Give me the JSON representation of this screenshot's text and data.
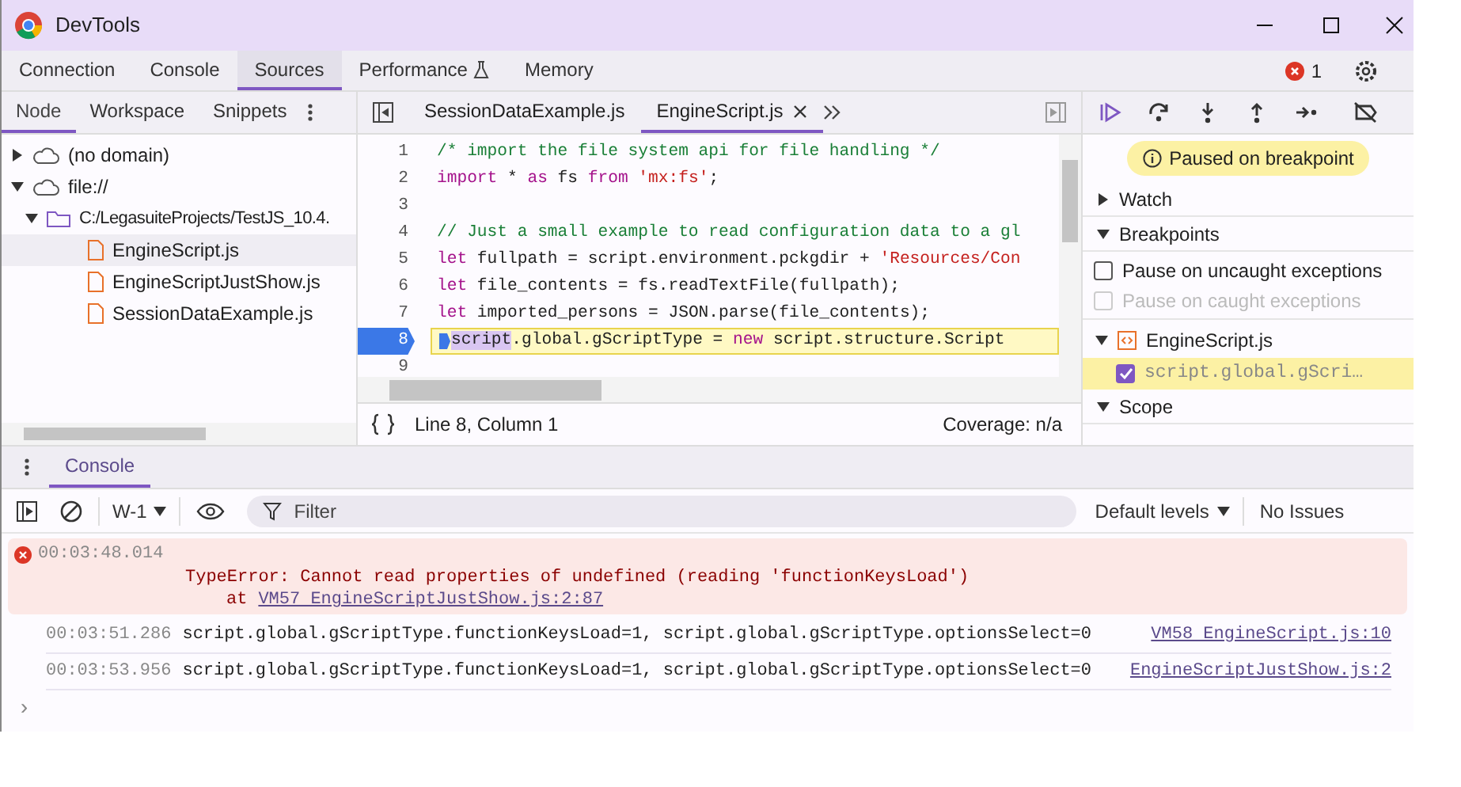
{
  "window": {
    "title": "DevTools"
  },
  "main_tabs": [
    {
      "label": "Connection",
      "selected": false,
      "kind": "plain"
    },
    {
      "label": "Console",
      "selected": false,
      "kind": "plain"
    },
    {
      "label": "Sources",
      "selected": true,
      "kind": "plain"
    },
    {
      "label": "Performance",
      "selected": false,
      "kind": "experimental"
    },
    {
      "label": "Memory",
      "selected": false,
      "kind": "plain"
    }
  ],
  "error_badge": {
    "count": "1"
  },
  "navigator": {
    "tabs": [
      {
        "label": "Node",
        "selected": true
      },
      {
        "label": "Workspace",
        "selected": false
      },
      {
        "label": "Snippets",
        "selected": false
      }
    ],
    "tree": [
      {
        "label": "(no domain)",
        "kind": "domain",
        "expanded": false
      },
      {
        "label": "file://",
        "kind": "domain",
        "expanded": true,
        "children": [
          {
            "label": "C:/LegasuiteProjects/TestJS_10.4.",
            "kind": "folder",
            "expanded": true,
            "children": [
              {
                "label": "EngineScript.js",
                "kind": "file",
                "selected": true
              },
              {
                "label": "EngineScriptJustShow.js",
                "kind": "file",
                "selected": false
              },
              {
                "label": "SessionDataExample.js",
                "kind": "file",
                "selected": false
              }
            ]
          }
        ]
      }
    ]
  },
  "editor": {
    "tabs": [
      {
        "label": "SessionDataExample.js",
        "selected": false
      },
      {
        "label": "EngineScript.js",
        "selected": true
      }
    ],
    "lines": [
      {
        "number": "1",
        "breakpoint": false,
        "segments": [
          {
            "kind": "comment",
            "text": "/* import the file system api for file handling */"
          }
        ]
      },
      {
        "number": "2",
        "breakpoint": false,
        "segments": [
          {
            "kind": "keyword",
            "text": "import"
          },
          {
            "kind": "plain",
            "text": " * "
          },
          {
            "kind": "keyword",
            "text": "as"
          },
          {
            "kind": "plain",
            "text": " fs "
          },
          {
            "kind": "keyword",
            "text": "from"
          },
          {
            "kind": "string",
            "text": " 'mx:fs'"
          },
          {
            "kind": "plain",
            "text": ";"
          }
        ]
      },
      {
        "number": "3",
        "breakpoint": false
      },
      {
        "number": "4",
        "breakpoint": false,
        "segments": [
          {
            "kind": "comment",
            "text": "// Just a small example to read configuration data to a gl"
          }
        ]
      },
      {
        "number": "5",
        "breakpoint": false,
        "segments": [
          {
            "kind": "keyword",
            "text": "let"
          },
          {
            "kind": "plain",
            "text": " fullpath = script.environment.pckgdir + "
          },
          {
            "kind": "string",
            "text": "'Resources/Con"
          }
        ]
      },
      {
        "number": "6",
        "breakpoint": false,
        "segments": [
          {
            "kind": "keyword",
            "text": "let"
          },
          {
            "kind": "plain",
            "text": " file_contents = fs.readTextFile(fullpath);"
          }
        ]
      },
      {
        "number": "7",
        "breakpoint": false,
        "segments": [
          {
            "kind": "keyword",
            "text": "let"
          },
          {
            "kind": "plain",
            "text": " imported_persons = JSON.parse(file_contents);"
          }
        ]
      },
      {
        "number": "8",
        "breakpoint": true,
        "segments": [
          {
            "kind": "highlight",
            "text": "script"
          },
          {
            "kind": "plain",
            "text": ".global.gScriptType = "
          },
          {
            "kind": "keyword",
            "text": "new"
          },
          {
            "kind": "plain",
            "text": " script.structure.Script"
          }
        ]
      },
      {
        "number": "9",
        "breakpoint": false
      }
    ],
    "status": {
      "position": "Line 8, Column 1",
      "coverage": "Coverage: n/a"
    }
  },
  "debugger": {
    "paused_message": "Paused on breakpoint",
    "sections": [
      {
        "title": "Watch",
        "expanded": false
      },
      {
        "title": "Breakpoints",
        "expanded": true
      },
      {
        "title": "Scope",
        "expanded": true
      }
    ],
    "options": [
      {
        "label": "Pause on uncaught exceptions",
        "checked": false,
        "disabled": false
      },
      {
        "label": "Pause on caught exceptions",
        "checked": false,
        "disabled": true
      }
    ],
    "breakpoint_file": {
      "name": "EngineScript.js",
      "expanded": true
    },
    "breakpoints": [
      {
        "text": "script.global.gScri…",
        "checked": true
      }
    ]
  },
  "console": {
    "tab": {
      "label": "Console",
      "selected": true
    },
    "context": "W-1",
    "filter_placeholder": "Filter",
    "levels": "Default levels",
    "issues": "No Issues",
    "messages": [
      {
        "kind": "error",
        "time": "00:03:48.014",
        "text": "TypeError: Cannot read properties of undefined (reading 'functionKeysLoad')",
        "at": "at",
        "link": "VM57 EngineScriptJustShow.js:2:87"
      },
      {
        "kind": "log",
        "time": "00:03:51.286",
        "text": "script.global.gScriptType.functionKeysLoad=1, script.global.gScriptType.optionsSelect=0",
        "link": "VM58 EngineScript.js:10"
      },
      {
        "kind": "log",
        "time": "00:03:53.956",
        "text": "script.global.gScriptType.functionKeysLoad=1, script.global.gScriptType.optionsSelect=0",
        "link": "EngineScriptJustShow.js:2"
      }
    ],
    "prompt": "›"
  }
}
